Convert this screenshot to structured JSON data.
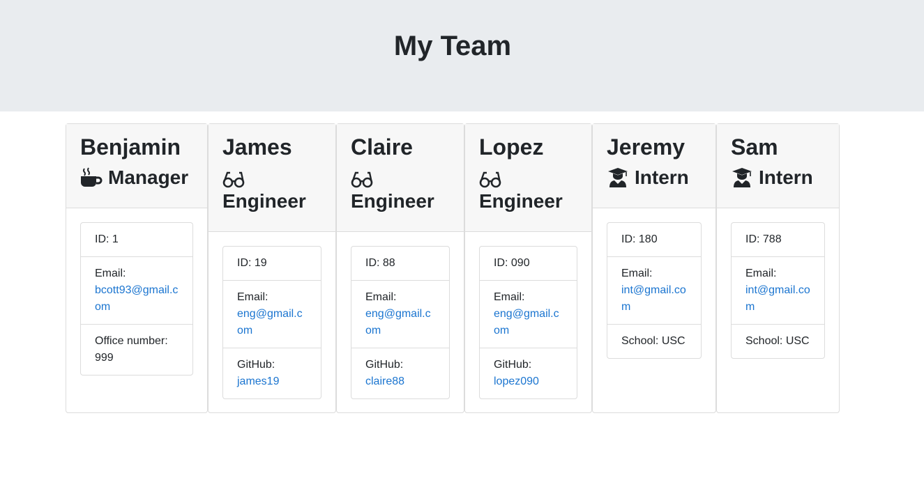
{
  "header": {
    "title": "My Team"
  },
  "cards": [
    {
      "name": "Benjamin",
      "role": "Manager",
      "icon": "coffee-icon",
      "id_text": "ID: 1",
      "email_label": "Email:",
      "email": "bcott93@gmail.com",
      "extra_label": "Office number:",
      "extra_value": "999"
    },
    {
      "name": "James",
      "role": "Engineer",
      "icon": "glasses-icon",
      "id_text": "ID: 19",
      "email_label": "Email:",
      "email": "eng@gmail.com",
      "extra_label": "GitHub:",
      "extra_value": "james19"
    },
    {
      "name": "Claire",
      "role": "Engineer",
      "icon": "glasses-icon",
      "id_text": "ID: 88",
      "email_label": "Email:",
      "email": "eng@gmail.com",
      "extra_label": "GitHub:",
      "extra_value": "claire88"
    },
    {
      "name": "Lopez",
      "role": "Engineer",
      "icon": "glasses-icon",
      "id_text": "ID: 090",
      "email_label": "Email:",
      "email": "eng@gmail.com",
      "extra_label": "GitHub:",
      "extra_value": "lopez090"
    },
    {
      "name": "Jeremy",
      "role": "Intern",
      "icon": "graduate-icon",
      "id_text": "ID: 180",
      "email_label": "Email:",
      "email": "int@gmail.com",
      "extra_label": "School:",
      "extra_value": "USC"
    },
    {
      "name": "Sam",
      "role": "Intern",
      "icon": "graduate-icon",
      "id_text": "ID: 788",
      "email_label": "Email:",
      "email": "int@gmail.com",
      "extra_label": "School:",
      "extra_value": "USC"
    }
  ],
  "colors": {
    "header_bg": "#e9ecef",
    "link": "#1b75d0",
    "card_header_bg": "#f7f7f7"
  }
}
